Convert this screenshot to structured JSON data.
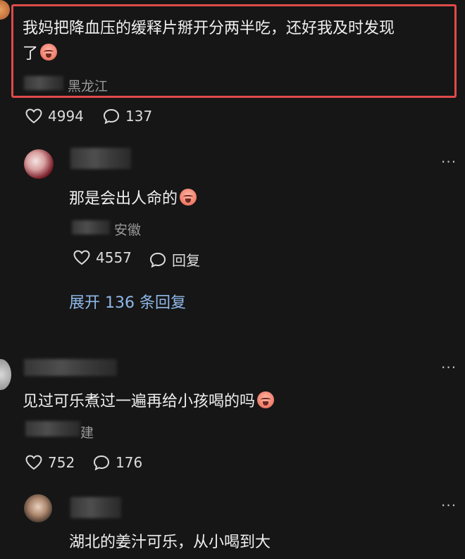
{
  "comments": [
    {
      "text_line1": "我妈把降血压的缓释片掰开分两半吃，还好我及时发现",
      "text_line2": "了",
      "emoji": "crying-face-emoji",
      "location": "黑龙江",
      "likes": "4994",
      "replies": "137"
    },
    {
      "text": "那是会出人命的",
      "emoji": "crying-face-emoji",
      "location": "安徽",
      "likes": "4557",
      "reply_label": "回复",
      "expand_label": "展开 136 条回复"
    },
    {
      "text": "见过可乐煮过一遍再给小孩喝的吗",
      "emoji": "crying-face-emoji",
      "location": "建",
      "likes": "752",
      "replies": "176"
    },
    {
      "text": "湖北的姜汁可乐，从小喝到大"
    }
  ],
  "more_icon": "···",
  "colors": {
    "background": "#161616",
    "highlight": "#e04a4a",
    "expand_link": "#8fb8e8"
  }
}
